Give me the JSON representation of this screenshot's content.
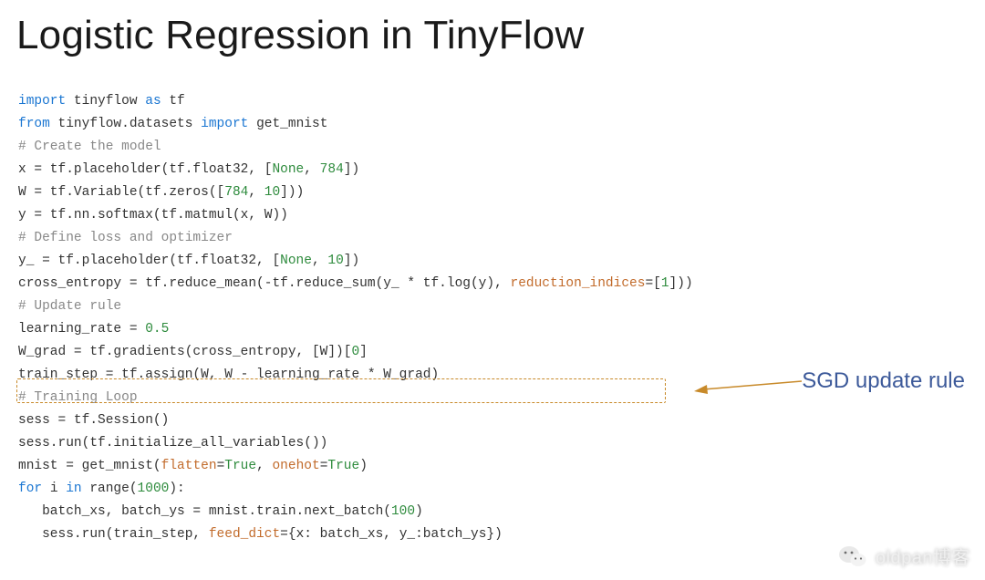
{
  "title": "Logistic Regression in TinyFlow",
  "annotation_label": "SGD update rule",
  "code": {
    "l01": {
      "kw1": "import",
      "mod1": "tinyflow",
      "kw2": "as",
      "alias": "tf"
    },
    "l02": {
      "kw1": "from",
      "mod1": "tinyflow.datasets",
      "kw2": "import",
      "name": "get_mnist"
    },
    "l03": {
      "comment": "# Create the model"
    },
    "l04": {
      "pre": "x = tf.placeholder(tf.float32, [",
      "none": "None",
      "mid": ", ",
      "n": "784",
      "post": "])"
    },
    "l05": {
      "pre": "W = tf.Variable(tf.zeros([",
      "n1": "784",
      "mid": ", ",
      "n2": "10",
      "post": "]))"
    },
    "l06": {
      "text": "y = tf.nn.softmax(tf.matmul(x, W))"
    },
    "l07": {
      "comment": "# Define loss and optimizer"
    },
    "l08": {
      "pre": "y_ = tf.placeholder(tf.float32, [",
      "none": "None",
      "mid": ", ",
      "n": "10",
      "post": "])"
    },
    "l09": {
      "pre": "cross_entropy = tf.reduce_mean(-tf.reduce_sum(y_ * tf.log(y), ",
      "kwarg": "reduction_indices",
      "eq": "=[",
      "n": "1",
      "post": "]))"
    },
    "l10": {
      "comment": "# Update rule"
    },
    "l11": {
      "pre": "learning_rate = ",
      "n": "0.5"
    },
    "l12": {
      "pre": "W_grad = tf.gradients(cross_entropy, [W])[",
      "n": "0",
      "post": "]"
    },
    "l13": {
      "text": "train_step = tf.assign(W, W - learning_rate * W_grad)"
    },
    "l14": {
      "comment": "# Training Loop"
    },
    "l15": {
      "text": "sess = tf.Session()"
    },
    "l16": {
      "text": "sess.run(tf.initialize_all_variables())"
    },
    "l17": {
      "pre": "mnist = get_mnist(",
      "kwarg1": "flatten",
      "eq1": "=",
      "b1": "True",
      "mid": ", ",
      "kwarg2": "onehot",
      "eq2": "=",
      "b2": "True",
      "post": ")"
    },
    "l18": {
      "kw1": "for",
      "var": "i",
      "kw2": "in",
      "fn": "range(",
      "n": "1000",
      "post": "):"
    },
    "l19": {
      "pre": "   batch_xs, batch_ys = mnist.train.next_batch(",
      "n": "100",
      "post": ")"
    },
    "l20": {
      "pre": "   sess.run(train_step, ",
      "kwarg": "feed_dict",
      "post": "={x: batch_xs, y_:batch_ys})"
    }
  },
  "watermark": {
    "text": "oldpan博客"
  }
}
